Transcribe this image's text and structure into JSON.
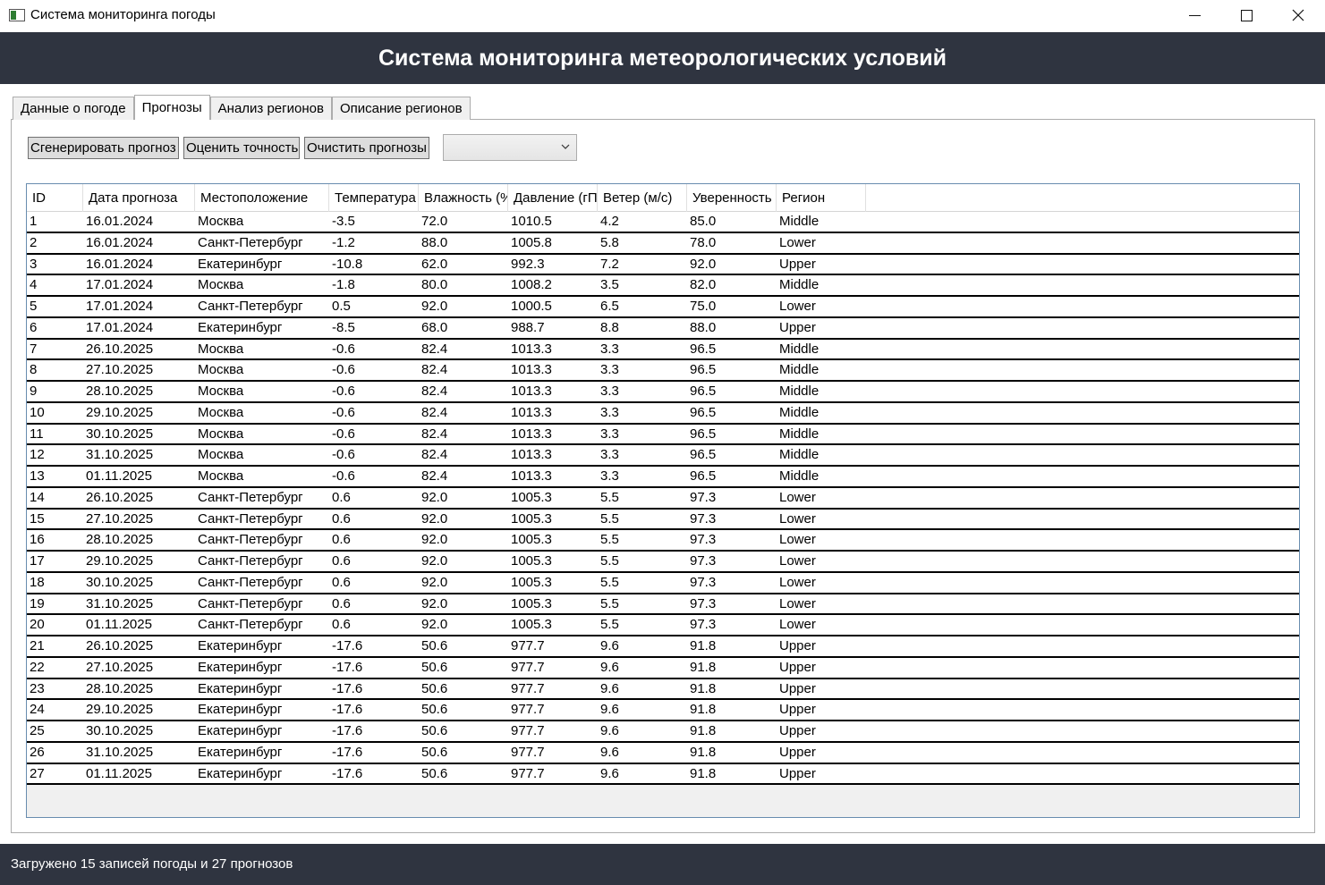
{
  "window": {
    "title": "Система мониторинга погоды"
  },
  "header": {
    "title": "Система мониторинга метеорологических условий"
  },
  "tabs": [
    {
      "label": "Данные о погоде",
      "active": false
    },
    {
      "label": "Прогнозы",
      "active": true
    },
    {
      "label": "Анализ регионов",
      "active": false
    },
    {
      "label": "Описание регионов",
      "active": false
    }
  ],
  "toolbar": {
    "generate_label": "Сгенерировать прогноз",
    "evaluate_label": "Оценить точность",
    "clear_label": "Очистить прогнозы",
    "combo_value": ""
  },
  "grid": {
    "columns": [
      "ID",
      "Дата прогноза",
      "Местоположение",
      "Температура",
      "Влажность (%",
      "Давление (гП",
      "Ветер (м/с)",
      "Уверенность",
      "Регион"
    ],
    "rows": [
      [
        "1",
        "16.01.2024",
        "Москва",
        "-3.5",
        "72.0",
        "1010.5",
        "4.2",
        "85.0",
        "Middle"
      ],
      [
        "2",
        "16.01.2024",
        "Санкт-Петербург",
        "-1.2",
        "88.0",
        "1005.8",
        "5.8",
        "78.0",
        "Lower"
      ],
      [
        "3",
        "16.01.2024",
        "Екатеринбург",
        "-10.8",
        "62.0",
        "992.3",
        "7.2",
        "92.0",
        "Upper"
      ],
      [
        "4",
        "17.01.2024",
        "Москва",
        "-1.8",
        "80.0",
        "1008.2",
        "3.5",
        "82.0",
        "Middle"
      ],
      [
        "5",
        "17.01.2024",
        "Санкт-Петербург",
        "0.5",
        "92.0",
        "1000.5",
        "6.5",
        "75.0",
        "Lower"
      ],
      [
        "6",
        "17.01.2024",
        "Екатеринбург",
        "-8.5",
        "68.0",
        "988.7",
        "8.8",
        "88.0",
        "Upper"
      ],
      [
        "7",
        "26.10.2025",
        "Москва",
        "-0.6",
        "82.4",
        "1013.3",
        "3.3",
        "96.5",
        "Middle"
      ],
      [
        "8",
        "27.10.2025",
        "Москва",
        "-0.6",
        "82.4",
        "1013.3",
        "3.3",
        "96.5",
        "Middle"
      ],
      [
        "9",
        "28.10.2025",
        "Москва",
        "-0.6",
        "82.4",
        "1013.3",
        "3.3",
        "96.5",
        "Middle"
      ],
      [
        "10",
        "29.10.2025",
        "Москва",
        "-0.6",
        "82.4",
        "1013.3",
        "3.3",
        "96.5",
        "Middle"
      ],
      [
        "11",
        "30.10.2025",
        "Москва",
        "-0.6",
        "82.4",
        "1013.3",
        "3.3",
        "96.5",
        "Middle"
      ],
      [
        "12",
        "31.10.2025",
        "Москва",
        "-0.6",
        "82.4",
        "1013.3",
        "3.3",
        "96.5",
        "Middle"
      ],
      [
        "13",
        "01.11.2025",
        "Москва",
        "-0.6",
        "82.4",
        "1013.3",
        "3.3",
        "96.5",
        "Middle"
      ],
      [
        "14",
        "26.10.2025",
        "Санкт-Петербург",
        "0.6",
        "92.0",
        "1005.3",
        "5.5",
        "97.3",
        "Lower"
      ],
      [
        "15",
        "27.10.2025",
        "Санкт-Петербург",
        "0.6",
        "92.0",
        "1005.3",
        "5.5",
        "97.3",
        "Lower"
      ],
      [
        "16",
        "28.10.2025",
        "Санкт-Петербург",
        "0.6",
        "92.0",
        "1005.3",
        "5.5",
        "97.3",
        "Lower"
      ],
      [
        "17",
        "29.10.2025",
        "Санкт-Петербург",
        "0.6",
        "92.0",
        "1005.3",
        "5.5",
        "97.3",
        "Lower"
      ],
      [
        "18",
        "30.10.2025",
        "Санкт-Петербург",
        "0.6",
        "92.0",
        "1005.3",
        "5.5",
        "97.3",
        "Lower"
      ],
      [
        "19",
        "31.10.2025",
        "Санкт-Петербург",
        "0.6",
        "92.0",
        "1005.3",
        "5.5",
        "97.3",
        "Lower"
      ],
      [
        "20",
        "01.11.2025",
        "Санкт-Петербург",
        "0.6",
        "92.0",
        "1005.3",
        "5.5",
        "97.3",
        "Lower"
      ],
      [
        "21",
        "26.10.2025",
        "Екатеринбург",
        "-17.6",
        "50.6",
        "977.7",
        "9.6",
        "91.8",
        "Upper"
      ],
      [
        "22",
        "27.10.2025",
        "Екатеринбург",
        "-17.6",
        "50.6",
        "977.7",
        "9.6",
        "91.8",
        "Upper"
      ],
      [
        "23",
        "28.10.2025",
        "Екатеринбург",
        "-17.6",
        "50.6",
        "977.7",
        "9.6",
        "91.8",
        "Upper"
      ],
      [
        "24",
        "29.10.2025",
        "Екатеринбург",
        "-17.6",
        "50.6",
        "977.7",
        "9.6",
        "91.8",
        "Upper"
      ],
      [
        "25",
        "30.10.2025",
        "Екатеринбург",
        "-17.6",
        "50.6",
        "977.7",
        "9.6",
        "91.8",
        "Upper"
      ],
      [
        "26",
        "31.10.2025",
        "Екатеринбург",
        "-17.6",
        "50.6",
        "977.7",
        "9.6",
        "91.8",
        "Upper"
      ],
      [
        "27",
        "01.11.2025",
        "Екатеринбург",
        "-17.6",
        "50.6",
        "977.7",
        "9.6",
        "91.8",
        "Upper"
      ]
    ]
  },
  "status": {
    "text": "Загружено 15 записей погоды и 27 прогнозов"
  },
  "icons": {
    "app": "app-window-icon",
    "minimize": "minimize-icon",
    "maximize": "maximize-icon",
    "close": "close-icon",
    "combo": "chevron-down-icon"
  },
  "colors": {
    "header_bg": "#2f3440",
    "status_bg": "#2f3440",
    "grid_border": "#688caf"
  }
}
